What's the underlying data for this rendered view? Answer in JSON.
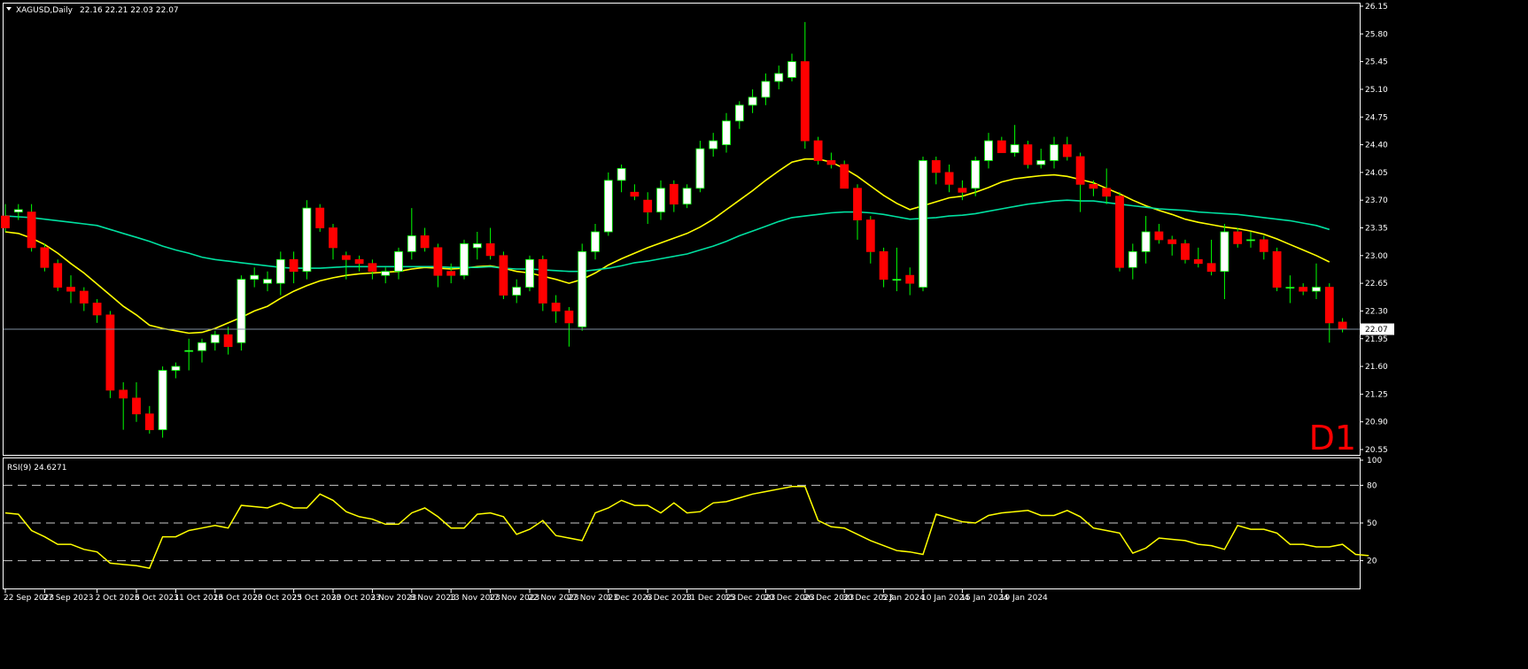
{
  "header": {
    "symbol": "XAGUSD,Daily",
    "ohlc": "22.16 22.21 22.03 22.07",
    "timeframe": "D1"
  },
  "rsi_panel": {
    "label": "RSI(9) 24.6271",
    "levels": [
      80,
      50,
      20
    ],
    "axis": [
      100,
      80,
      50,
      20
    ]
  },
  "colors": {
    "background": "#000000",
    "bull_body": "#ffffff",
    "bear_body": "#ff0000",
    "wick": "#00ff00",
    "ma_fast": "#ffff00",
    "ma_slow": "#00e0a0",
    "rsi_line": "#ffff00",
    "frame": "#ffffff",
    "timeframe_label": "#ff0000"
  },
  "chart_data": {
    "type": "candlestick",
    "price_axis": {
      "ticks": [
        "26.15",
        "25.80",
        "25.45",
        "25.10",
        "24.75",
        "24.40",
        "24.05",
        "23.70",
        "23.35",
        "23.00",
        "22.65",
        "22.30",
        "21.95",
        "21.60",
        "21.25",
        "20.90",
        "20.55"
      ],
      "range": [
        20.55,
        26.15
      ],
      "current_price": 22.07,
      "current_label": "22.07"
    },
    "time_axis": {
      "labels": [
        "22 Sep 2023",
        "27 Sep 2023",
        "2 Oct 2023",
        "6 Oct 2023",
        "11 Oct 2023",
        "16 Oct 2023",
        "20 Oct 2023",
        "25 Oct 2023",
        "30 Oct 2023",
        "3 Nov 2023",
        "8 Nov 2023",
        "13 Nov 2023",
        "17 Nov 2023",
        "22 Nov 2023",
        "27 Nov 2023",
        "1 Dec 2023",
        "6 Dec 2023",
        "11 Dec 2023",
        "15 Dec 2023",
        "20 Dec 2023",
        "26 Dec 2023",
        "30 Dec 2023",
        "5 Jan 2024",
        "10 Jan 2024",
        "15 Jan 2024",
        "19 Jan 2024"
      ],
      "label_index": [
        0,
        3,
        7,
        10,
        13,
        16,
        19,
        22,
        25,
        28,
        31,
        34,
        37,
        40,
        43,
        46,
        49,
        52,
        55,
        58,
        61,
        64,
        67,
        70,
        73,
        76
      ]
    },
    "candles": [
      [
        23.5,
        23.65,
        23.3,
        23.35
      ],
      [
        23.55,
        23.65,
        23.45,
        23.58
      ],
      [
        23.55,
        23.65,
        23.05,
        23.1
      ],
      [
        23.1,
        23.15,
        22.8,
        22.85
      ],
      [
        22.9,
        22.95,
        22.55,
        22.6
      ],
      [
        22.6,
        22.75,
        22.4,
        22.55
      ],
      [
        22.55,
        22.6,
        22.3,
        22.4
      ],
      [
        22.4,
        22.45,
        22.15,
        22.25
      ],
      [
        22.25,
        22.3,
        21.2,
        21.3
      ],
      [
        21.3,
        21.4,
        20.8,
        21.2
      ],
      [
        21.2,
        21.4,
        20.9,
        21.0
      ],
      [
        21.0,
        21.1,
        20.75,
        20.8
      ],
      [
        20.8,
        21.6,
        20.7,
        21.55
      ],
      [
        21.55,
        21.65,
        21.45,
        21.6
      ],
      [
        21.8,
        21.95,
        21.55,
        21.8
      ],
      [
        21.8,
        21.95,
        21.65,
        21.9
      ],
      [
        21.9,
        22.05,
        21.8,
        22.0
      ],
      [
        22.0,
        22.1,
        21.75,
        21.85
      ],
      [
        21.9,
        22.75,
        21.8,
        22.7
      ],
      [
        22.7,
        22.85,
        22.6,
        22.75
      ],
      [
        22.65,
        22.8,
        22.55,
        22.7
      ],
      [
        22.65,
        23.05,
        22.5,
        22.95
      ],
      [
        22.95,
        23.05,
        22.65,
        22.8
      ],
      [
        22.8,
        23.7,
        22.7,
        23.6
      ],
      [
        23.6,
        23.65,
        23.3,
        23.35
      ],
      [
        23.35,
        23.4,
        22.95,
        23.1
      ],
      [
        23.0,
        23.05,
        22.7,
        22.95
      ],
      [
        22.95,
        23.0,
        22.8,
        22.9
      ],
      [
        22.9,
        22.95,
        22.7,
        22.8
      ],
      [
        22.75,
        22.85,
        22.65,
        22.8
      ],
      [
        22.8,
        23.1,
        22.7,
        23.05
      ],
      [
        23.05,
        23.6,
        22.95,
        23.25
      ],
      [
        23.25,
        23.35,
        23.05,
        23.1
      ],
      [
        23.1,
        23.15,
        22.6,
        22.75
      ],
      [
        22.8,
        22.9,
        22.65,
        22.75
      ],
      [
        22.75,
        23.2,
        22.7,
        23.15
      ],
      [
        23.1,
        23.3,
        22.95,
        23.15
      ],
      [
        23.15,
        23.35,
        22.95,
        23.0
      ],
      [
        23.0,
        23.05,
        22.45,
        22.5
      ],
      [
        22.5,
        22.7,
        22.4,
        22.6
      ],
      [
        22.6,
        23.0,
        22.55,
        22.95
      ],
      [
        22.95,
        23.0,
        22.3,
        22.4
      ],
      [
        22.4,
        22.5,
        22.15,
        22.3
      ],
      [
        22.3,
        22.35,
        21.85,
        22.15
      ],
      [
        22.1,
        23.15,
        22.05,
        23.05
      ],
      [
        23.05,
        23.4,
        22.95,
        23.3
      ],
      [
        23.3,
        24.05,
        23.25,
        23.95
      ],
      [
        23.95,
        24.15,
        23.8,
        24.1
      ],
      [
        23.8,
        23.9,
        23.7,
        23.75
      ],
      [
        23.7,
        23.8,
        23.4,
        23.55
      ],
      [
        23.55,
        23.95,
        23.45,
        23.85
      ],
      [
        23.9,
        23.95,
        23.55,
        23.65
      ],
      [
        23.65,
        23.9,
        23.6,
        23.85
      ],
      [
        23.85,
        24.45,
        23.8,
        24.35
      ],
      [
        24.35,
        24.55,
        24.25,
        24.45
      ],
      [
        24.4,
        24.8,
        24.3,
        24.7
      ],
      [
        24.7,
        24.95,
        24.6,
        24.9
      ],
      [
        24.9,
        25.1,
        24.8,
        25.0
      ],
      [
        25.0,
        25.3,
        24.9,
        25.2
      ],
      [
        25.2,
        25.4,
        25.1,
        25.3
      ],
      [
        25.25,
        25.55,
        25.2,
        25.45
      ],
      [
        25.45,
        25.95,
        24.35,
        24.45
      ],
      [
        24.45,
        24.5,
        24.15,
        24.2
      ],
      [
        24.2,
        24.3,
        24.1,
        24.15
      ],
      [
        24.15,
        24.2,
        23.9,
        23.85
      ],
      [
        23.85,
        23.9,
        23.2,
        23.45
      ],
      [
        23.45,
        23.5,
        22.9,
        23.05
      ],
      [
        23.05,
        23.1,
        22.6,
        22.7
      ],
      [
        22.7,
        23.1,
        22.55,
        22.7
      ],
      [
        22.75,
        22.85,
        22.5,
        22.65
      ],
      [
        22.6,
        24.25,
        22.55,
        24.2
      ],
      [
        24.2,
        24.25,
        23.9,
        24.05
      ],
      [
        24.05,
        24.15,
        23.8,
        23.9
      ],
      [
        23.85,
        23.95,
        23.7,
        23.8
      ],
      [
        23.85,
        24.25,
        23.75,
        24.2
      ],
      [
        24.2,
        24.55,
        24.1,
        24.45
      ],
      [
        24.45,
        24.5,
        24.3,
        24.3
      ],
      [
        24.3,
        24.65,
        24.25,
        24.4
      ],
      [
        24.4,
        24.45,
        24.1,
        24.15
      ],
      [
        24.15,
        24.35,
        24.1,
        24.2
      ],
      [
        24.2,
        24.5,
        24.1,
        24.4
      ],
      [
        24.4,
        24.5,
        24.2,
        24.25
      ],
      [
        24.25,
        24.3,
        23.55,
        23.9
      ],
      [
        23.9,
        23.95,
        23.75,
        23.85
      ],
      [
        23.85,
        24.1,
        23.65,
        23.75
      ],
      [
        23.75,
        23.8,
        22.8,
        22.85
      ],
      [
        22.85,
        23.15,
        22.7,
        23.05
      ],
      [
        23.05,
        23.5,
        22.9,
        23.3
      ],
      [
        23.3,
        23.4,
        23.15,
        23.2
      ],
      [
        23.2,
        23.25,
        23.0,
        23.15
      ],
      [
        23.15,
        23.2,
        22.9,
        22.95
      ],
      [
        22.95,
        23.1,
        22.85,
        22.9
      ],
      [
        22.9,
        23.2,
        22.75,
        22.8
      ],
      [
        22.8,
        23.4,
        22.45,
        23.3
      ],
      [
        23.3,
        23.35,
        23.1,
        23.15
      ],
      [
        23.2,
        23.3,
        23.1,
        23.2
      ],
      [
        23.2,
        23.25,
        22.95,
        23.05
      ],
      [
        23.05,
        23.1,
        22.55,
        22.6
      ],
      [
        22.6,
        22.75,
        22.4,
        22.6
      ],
      [
        22.6,
        22.65,
        22.5,
        22.55
      ],
      [
        22.55,
        22.9,
        22.45,
        22.6
      ],
      [
        22.6,
        22.65,
        21.9,
        22.15
      ],
      [
        22.16,
        22.21,
        22.03,
        22.07
      ]
    ],
    "series": [
      {
        "values": [
          23.3,
          23.28,
          23.22,
          23.14,
          23.03,
          22.9,
          22.78,
          22.64,
          22.5,
          22.36,
          22.25,
          22.12,
          22.08,
          22.05,
          22.02,
          22.03,
          22.08,
          22.15,
          22.22,
          22.3,
          22.36,
          22.46,
          22.55,
          22.62,
          22.68,
          22.72,
          22.75,
          22.77,
          22.78,
          22.79,
          22.8,
          22.83,
          22.85,
          22.84,
          22.83,
          22.84,
          22.86,
          22.87,
          22.84,
          22.8,
          22.78,
          22.74,
          22.7,
          22.65,
          22.7,
          22.78,
          22.88,
          22.96,
          23.03,
          23.1,
          23.16,
          23.22,
          23.28,
          23.36,
          23.46,
          23.58,
          23.7,
          23.82,
          23.95,
          24.07,
          24.18,
          24.22,
          24.22,
          24.18,
          24.1,
          24.0,
          23.88,
          23.76,
          23.66,
          23.58,
          23.63,
          23.68,
          23.73,
          23.75,
          23.8,
          23.86,
          23.93,
          23.97,
          23.99,
          24.01,
          24.02,
          24.0,
          23.96,
          23.92,
          23.85,
          23.78,
          23.7,
          23.63,
          23.57,
          23.52,
          23.46,
          23.42,
          23.39,
          23.36,
          23.34,
          23.31,
          23.27,
          23.21,
          23.14,
          23.07,
          23.0,
          22.92
        ]
      },
      {
        "values": [
          23.5,
          23.49,
          23.48,
          23.46,
          23.44,
          23.42,
          23.4,
          23.38,
          23.33,
          23.28,
          23.23,
          23.18,
          23.12,
          23.07,
          23.03,
          22.98,
          22.95,
          22.93,
          22.91,
          22.89,
          22.87,
          22.85,
          22.84,
          22.84,
          22.84,
          22.85,
          22.86,
          22.86,
          22.86,
          22.86,
          22.86,
          22.86,
          22.86,
          22.86,
          22.85,
          22.85,
          22.85,
          22.86,
          22.84,
          22.83,
          22.83,
          22.82,
          22.81,
          22.8,
          22.8,
          22.82,
          22.84,
          22.87,
          22.91,
          22.93,
          22.96,
          22.99,
          23.02,
          23.07,
          23.12,
          23.18,
          23.25,
          23.31,
          23.37,
          23.43,
          23.48,
          23.5,
          23.52,
          23.54,
          23.55,
          23.55,
          23.54,
          23.52,
          23.49,
          23.46,
          23.47,
          23.48,
          23.5,
          23.51,
          23.53,
          23.56,
          23.59,
          23.62,
          23.65,
          23.67,
          23.69,
          23.7,
          23.69,
          23.69,
          23.67,
          23.65,
          23.63,
          23.61,
          23.59,
          23.58,
          23.57,
          23.55,
          23.54,
          23.53,
          23.52,
          23.5,
          23.48,
          23.46,
          23.44,
          23.41,
          23.38,
          23.33
        ]
      }
    ],
    "rsi": [
      58,
      57,
      44,
      39,
      33,
      33,
      29,
      27,
      18,
      17,
      16,
      14,
      39,
      39,
      44,
      46,
      48,
      46,
      64,
      63,
      62,
      66,
      62,
      62,
      73,
      68,
      59,
      55,
      53,
      49,
      49,
      58,
      62,
      55,
      46,
      46,
      57,
      58,
      55,
      41,
      45,
      52,
      40,
      38,
      36,
      58,
      62,
      68,
      64,
      64,
      58,
      66,
      58,
      59,
      66,
      67,
      70,
      73,
      75,
      77,
      79,
      79,
      52,
      47,
      46,
      41,
      36,
      32,
      28,
      27,
      25,
      57,
      54,
      51,
      50,
      56,
      58,
      59,
      60,
      56,
      56,
      60,
      55,
      46,
      44,
      42,
      26,
      30,
      38,
      37,
      36,
      33,
      32,
      29,
      48,
      45,
      45,
      42,
      33,
      33,
      31,
      31,
      33,
      25,
      24
    ],
    "rsi_ylim": [
      0,
      100
    ],
    "ylim": [
      20.55,
      26.15
    ]
  }
}
